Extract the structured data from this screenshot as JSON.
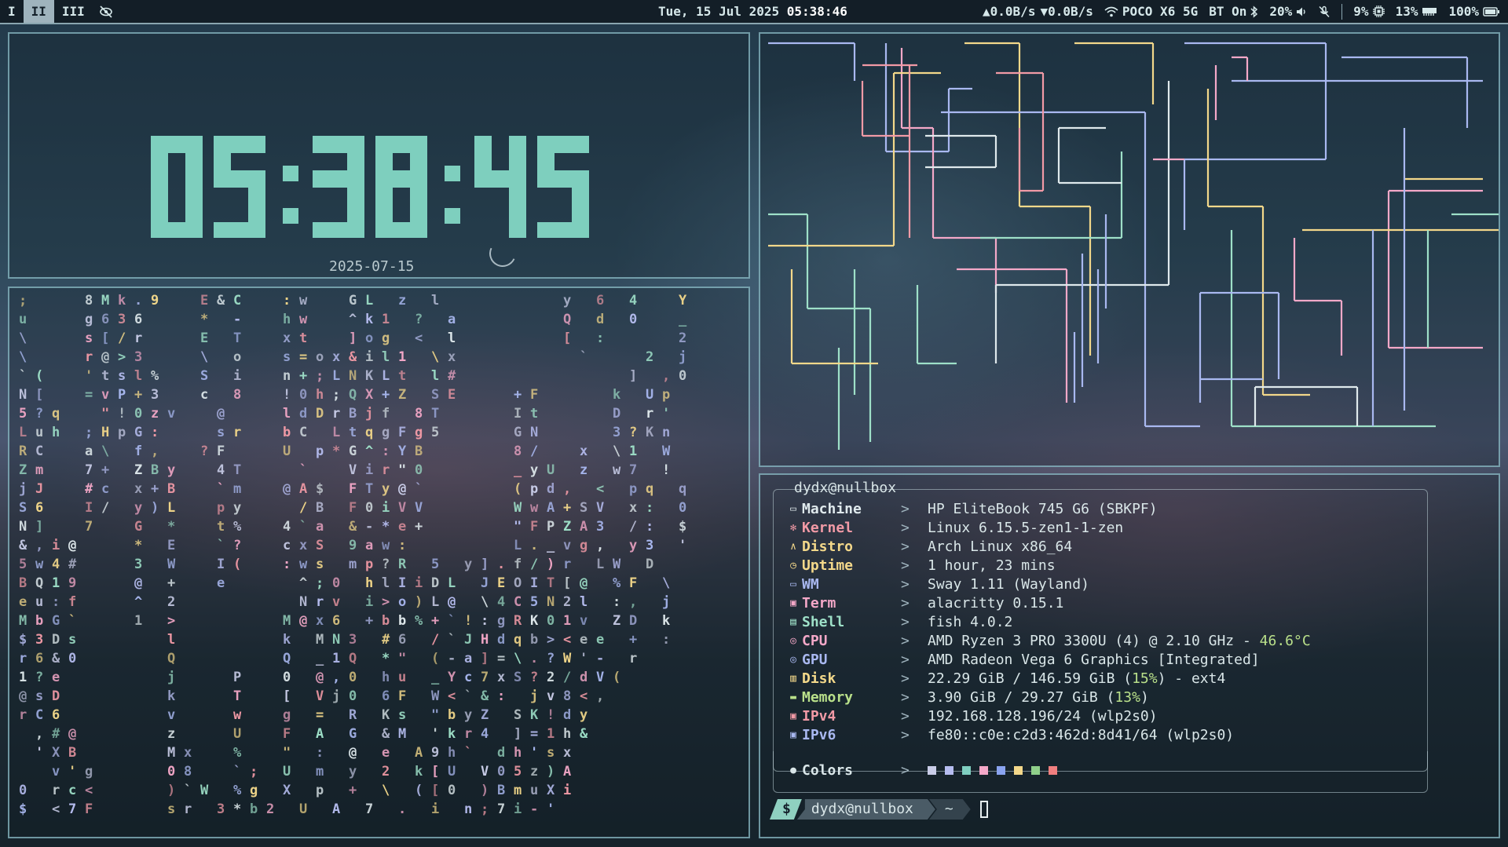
{
  "topbar": {
    "workspaces": [
      {
        "label": "I",
        "active": false
      },
      {
        "label": "II",
        "active": true
      },
      {
        "label": "III",
        "active": false
      }
    ],
    "idle_icon": "eye-off-icon",
    "datetime": {
      "date": "Tue, 15 Jul 2025",
      "time": "05:38:46"
    },
    "net_up": "▲0.0B/s",
    "net_down": "▼0.0B/s",
    "wifi_name": "POCO X6 5G",
    "bluetooth": "BT On",
    "volume": "20%",
    "cpu": "9%",
    "memory": "13%",
    "battery": "100%"
  },
  "clock": {
    "time": "05:38:45",
    "date": "2025-07-15"
  },
  "matrix": {
    "rows": [
      ";   8Mk.9  E&C  :w  GL z l       y 6 4  Y",
      "u   g636   * -  hw  ^k1 ? a      Q d 0  _",
      "\\   s[/r   E T  xt  ]og < l      [ :    2",
      "\\   r@>3   \\ o  s=ox&il1 \\x       `   2 j",
      "`(  'tsl%  S i  n+;LNKLt l#          ] ,0",
      "N[  =vP+3  c 8  !0h;QX+Z SE   +F    k Up",
      "5?q  \"!0zv  @   ldDrBjf 8T    It    D r'",
      "Luh ;HpG:   sr  bC LtqgFg5    GN    3?Kn",
      "RC  a\\ f,  ?F   U p*G^:YB     8/  x \\1 W",
      "Zm  7+ ZBy  4T   `  Vir\"0     _yU z w7 !",
      "jJ  #c x+B  `m  @A$ FTy@`     (pd, < pq q",
      "S6  I/ y)L  py   /B F0iVV     WwA+SV x: 0",
      "N]  7  G *  t%  4`a &-*e+     \"FPZA3 /: $",
      "&,i@   * E  `?  cxS 9aw:      L._vg, y3 '",
      "5w4#   3 W  I(  :ws mp?R 5 y].f/)r LW D",
      "BQ19   @ +  e    ^;0 hlIiDL JEOIT[@ %F \\",
      "eu:f   ^ 2       Nrv i>o)L@ \\4C5N2l :, j",
      "MbG`   1 >      M@x6 +bb%+`!:gRK01v ZD k",
      "$3Ds     l      k MN3 #6 /`JHdqb><ee + :",
      "r6&0     Q      Q _1Q *\" (-a]=\\.?W'- r",
      "1?e      j   P  0 @,0 hu _Yc7xS?2/dV(",
      "@sD      k   T  [ Vj0 6F W<`&: jv8<,",
      "rC6      v   w  g = R Ks \"byZ SK!dy",
      " ,#@     z   U  F A G &M 'kr4 ]=1h&",
      " 'XB     Mx  %  \" : @ e A9h` dh'sx",
      "  v'g    08  `; U m y 2 k[U V05z)A",
      "0 rc<    )`W %g X p + \\ ([0 )BmuXi",
      "$ <7F    sr 3*b2 U A 7 . i n;7i-'"
    ]
  },
  "fetch": {
    "title": "dydx@nullbox",
    "separator": ">",
    "rows": [
      {
        "icon": "laptop-icon",
        "key": "Machine",
        "value": "HP EliteBook 745 G6 (SBKPF)",
        "color": "#dfe9ec"
      },
      {
        "icon": "gear-icon",
        "key": "Kernel",
        "value": "Linux 6.15.5-zen1-1-zen",
        "color": "#f29aa6"
      },
      {
        "icon": "arch-logo-icon",
        "key": "Distro",
        "value": "Arch Linux x86_64",
        "color": "#f3d88a"
      },
      {
        "icon": "clock-icon",
        "key": "Uptime",
        "value": "1 hour, 23 mins",
        "color": "#f3d88a"
      },
      {
        "icon": "window-icon",
        "key": "WM",
        "value": "Sway 1.11 (Wayland)",
        "color": "#a9b8f0"
      },
      {
        "icon": "terminal-icon",
        "key": "Term",
        "value": "alacritty 0.15.1",
        "color": "#f4a8c8"
      },
      {
        "icon": "shell-icon",
        "key": "Shell",
        "value": "fish 4.0.2",
        "color": "#9ee0c8"
      },
      {
        "icon": "cpu-icon",
        "key": "CPU",
        "value": "AMD Ryzen 3 PRO 3300U (4) @ 2.10 GHz - ",
        "extra": "46.6°C",
        "color": "#f4a8c8"
      },
      {
        "icon": "gpu-icon",
        "key": "GPU",
        "value": "AMD Radeon Vega 6 Graphics [Integrated]",
        "color": "#a9b8f0"
      },
      {
        "icon": "disk-icon",
        "key": "Disk",
        "value": "22.29 GiB / 146.59 GiB (",
        "extra": "15%",
        "tail": ") - ext4",
        "color": "#f3d88a"
      },
      {
        "icon": "memory-icon",
        "key": "Memory",
        "value": "3.90 GiB / 29.27 GiB (",
        "extra": "13%",
        "tail": ")",
        "color": "#b9e08a"
      },
      {
        "icon": "network-icon",
        "key": "IPv4",
        "value": "192.168.128.196/24 (wlp2s0)",
        "color": "#f29aa6"
      },
      {
        "icon": "network-icon",
        "key": "IPv6",
        "value": "fe80::c0e:c2d3:462d:8d41/64 (wlp2s0)",
        "color": "#a9b8f0"
      }
    ],
    "colors_label": "Colors",
    "swatches": [
      "#c9cde8",
      "#b6bdf0",
      "#7fcfc0",
      "#f4a8c8",
      "#8aa4f0",
      "#f3d88a",
      "#8fd08a",
      "#f07f7f"
    ]
  },
  "prompt": {
    "symbol": "$",
    "user": "dydx@nullbox",
    "dir": "~"
  }
}
